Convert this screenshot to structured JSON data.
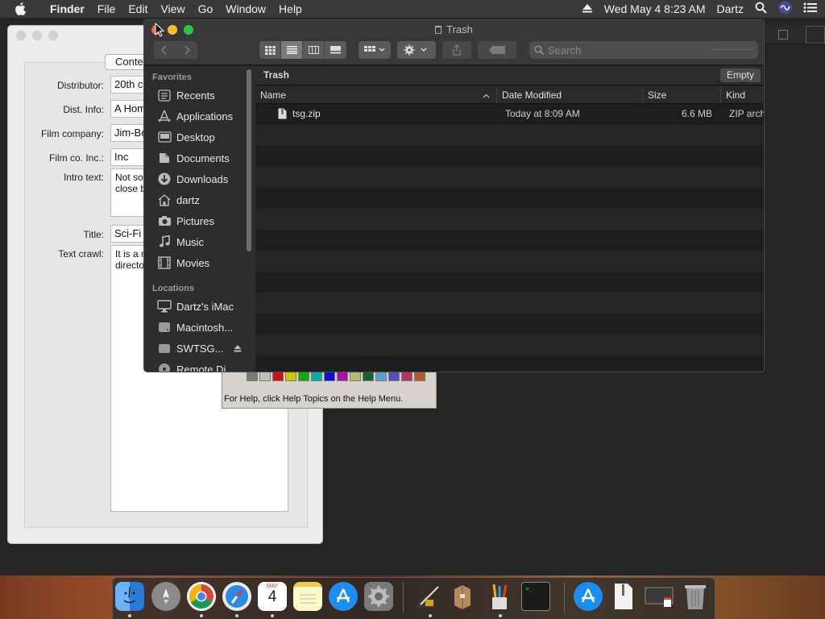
{
  "menubar": {
    "app_name": "Finder",
    "items": [
      "File",
      "Edit",
      "View",
      "Go",
      "Window",
      "Help"
    ],
    "datetime": "Wed May 4  8:23 AM",
    "user": "Dartz"
  },
  "background_app": {
    "tab_label": "Conte",
    "fields": [
      {
        "label": "Distributor:",
        "value": "20th c"
      },
      {
        "label": "Dist. Info:",
        "value": "A Hom"
      },
      {
        "label": "Film company:",
        "value": "Jim-Be"
      },
      {
        "label": "Film co. Inc.:",
        "value": "Inc"
      },
      {
        "label": "Intro text:",
        "value": "Not so\nclose b"
      },
      {
        "label": "Title:",
        "value": "Sci-Fi"
      },
      {
        "label": "Text crawl:",
        "value": "It is a m\ndirecto"
      }
    ]
  },
  "paint_window": {
    "status_text": "For Help, click Help Topics on the Help Menu.",
    "palette_colors": [
      "#7a7a7a",
      "#c0c0c0",
      "#cc1111",
      "#c8c800",
      "#11aa11",
      "#11aaaa",
      "#1111cc",
      "#aa11aa",
      "#b8b86a",
      "#116633",
      "#5aa0d0",
      "#5050c0",
      "#bb3366",
      "#b05a2a"
    ]
  },
  "finder": {
    "title": "Trash",
    "search_placeholder": "Search",
    "path_title": "Trash",
    "empty_button": "Empty",
    "sidebar": {
      "favorites_header": "Favorites",
      "favorites": [
        {
          "label": "Recents",
          "icon": "recents-icon"
        },
        {
          "label": "Applications",
          "icon": "applications-icon"
        },
        {
          "label": "Desktop",
          "icon": "desktop-icon"
        },
        {
          "label": "Documents",
          "icon": "documents-icon"
        },
        {
          "label": "Downloads",
          "icon": "downloads-icon"
        },
        {
          "label": "dartz",
          "icon": "home-icon"
        },
        {
          "label": "Pictures",
          "icon": "pictures-icon"
        },
        {
          "label": "Music",
          "icon": "music-icon"
        },
        {
          "label": "Movies",
          "icon": "movies-icon"
        }
      ],
      "locations_header": "Locations",
      "locations": [
        {
          "label": "Dartz's iMac",
          "icon": "imac-icon"
        },
        {
          "label": "Macintosh...",
          "icon": "disk-icon"
        },
        {
          "label": "SWTSG...",
          "icon": "external-disk-icon"
        },
        {
          "label": "Remote Di...",
          "icon": "remote-disc-icon"
        }
      ]
    },
    "columns": [
      "Name",
      "Date Modified",
      "Size",
      "Kind"
    ],
    "files": [
      {
        "name": "tsg.zip",
        "date": "Today at 8:09 AM",
        "size": "6.6 MB",
        "kind": "ZIP arch"
      }
    ]
  },
  "dock": {
    "apps": [
      "finder-icon",
      "launchpad-icon",
      "chrome-icon",
      "safari-icon",
      "calendar-icon",
      "notes-icon",
      "app-store-icon",
      "system-preferences-icon",
      "xcode-instruments-icon",
      "archive-utility-icon",
      "pencil-cup-icon",
      "terminal-icon",
      "app-store-download-icon",
      "zip-file-icon",
      "calendar-doc-icon",
      "trash-icon"
    ],
    "calendar_month": "MAY",
    "calendar_day": "4"
  },
  "colors": {
    "close": "#ff5f57",
    "minimize": "#febc2e",
    "zoom": "#28c840",
    "finder_bg": "#1e1e1e",
    "sidebar_bg": "#2d2d2d"
  }
}
